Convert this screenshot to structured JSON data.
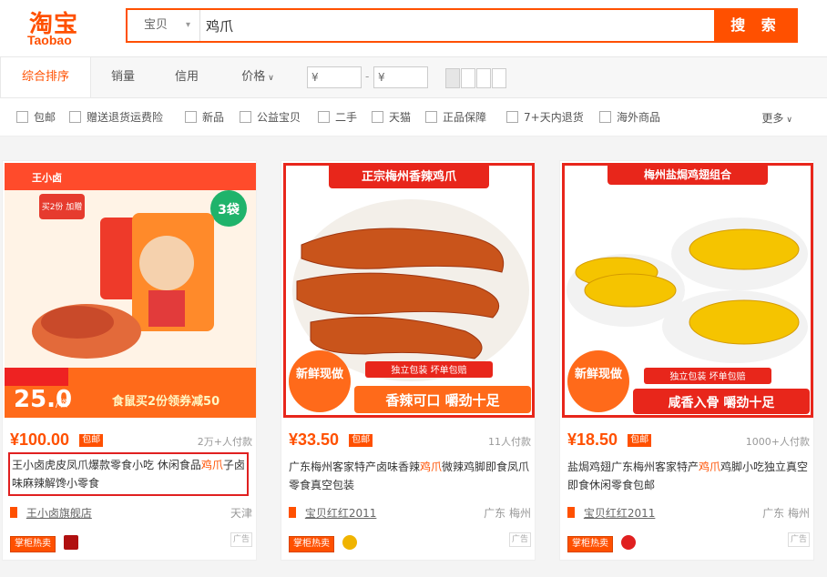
{
  "brand": {
    "logo_cn": "淘宝",
    "logo_en": "Taobao",
    "color": "#ff5000"
  },
  "search": {
    "category": "宝贝",
    "query": "鸡爪",
    "button": "搜 索"
  },
  "sort": {
    "tabs": [
      "综合排序",
      "销量",
      "信用",
      "价格"
    ],
    "price_min_placeholder": "¥",
    "price_max_placeholder": "¥",
    "range_sep": "-"
  },
  "filters": {
    "options": [
      "包邮",
      "赠送退货运费险",
      "新品",
      "公益宝贝",
      "二手",
      "天猫",
      "正品保障",
      "7+天内退货",
      "海外商品"
    ],
    "more": "更多"
  },
  "products": [
    {
      "price": "¥100.00",
      "free_ship": "包邮",
      "paid": "2万+人付款",
      "title_before": "王小卤虎皮凤爪爆款零食小吃 休闲食品",
      "title_hl": "鸡爪",
      "title_after": "子卤味麻辣解馋小零食",
      "shop": "王小卤旗舰店",
      "location": "天津",
      "tag": "掌柜热卖",
      "ad": "广告",
      "img": {
        "brand": "王小卤",
        "badge": "3袋",
        "promo": "买2份 加赠",
        "price_big": "25.0",
        "price_unit": "/袋",
        "coupon": "食鼠买2份领券减50"
      }
    },
    {
      "price": "¥33.50",
      "free_ship": "包邮",
      "paid": "11人付款",
      "title_before": "广东梅州客家特产卤味香辣",
      "title_hl": "鸡爪",
      "title_after": "微辣鸡脚即食凤爪零食真空包装",
      "shop": "宝贝红红2011",
      "location": "广东 梅州",
      "tag": "掌柜热卖",
      "ad": "广告",
      "img": {
        "banner": "正宗梅州香辣鸡爪",
        "fresh": "新鲜现做",
        "pack": "独立包装 坏单包赔",
        "slogan": "香辣可口 嚼劲十足"
      }
    },
    {
      "price": "¥18.50",
      "free_ship": "包邮",
      "paid": "1000+人付款",
      "title_before": "盐焗鸡翅广东梅州客家特产",
      "title_hl": "鸡爪",
      "title_after": "鸡脚小吃独立真空即食休闲零食包邮",
      "shop": "宝贝红红2011",
      "location": "广东 梅州",
      "tag": "掌柜热卖",
      "ad": "广告",
      "img": {
        "banner": "梅州盐焗鸡翅组合",
        "fresh": "新鲜现做",
        "pack": "独立包装 坏单包赔",
        "slogan": "咸香入骨 嚼劲十足"
      }
    }
  ]
}
